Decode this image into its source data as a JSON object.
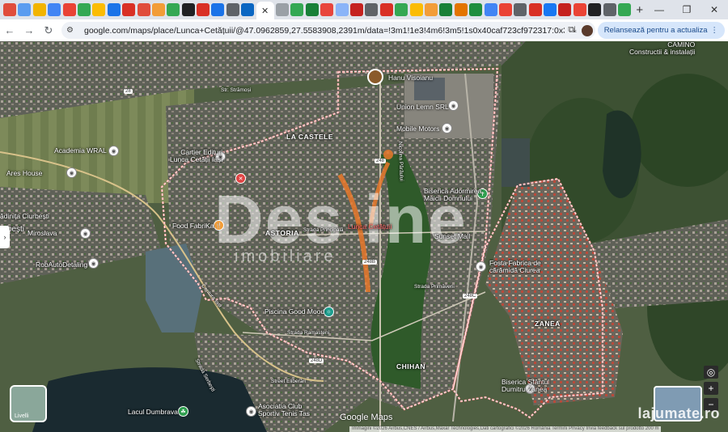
{
  "browser": {
    "url": "google.com/maps/place/Lunca+Cetățuii/@47.0962859,27.5583908,2391m/data=!3m1!1e3!4m6!3m5!1s0x40caf723cf972317:0x373eac97b60d4dbc!8m2!3d47.0968...",
    "relaunch_label": "Relansează pentru a actualiza",
    "tab_colors": [
      "#e04d3c",
      "#5a9cf0",
      "#f2b400",
      "#4285f4",
      "#e94235",
      "#34a853",
      "#fbbc04",
      "#1a73e8",
      "#d93025",
      "#e04d3c",
      "#f29d38",
      "#34a853",
      "#202124",
      "#d93025",
      "#1a73e8",
      "#5f6368",
      "#0a66c2",
      "#9aa0a6",
      "#34a853",
      "#188038",
      "#e8453c",
      "#8ab4f8",
      "#c5221f",
      "#5f6368",
      "#d93025",
      "#34a853",
      "#fbbc04",
      "#f29d38",
      "#188038",
      "#e37400",
      "#1e8e3e",
      "#4285f4",
      "#ea4335",
      "#5f6368",
      "#d93025",
      "#1877f2",
      "#c5221f",
      "#ea4335",
      "#202124",
      "#5f6368",
      "#34a853"
    ]
  },
  "map": {
    "areas": [
      "LA CASTELE",
      "ASTORIA",
      "ZANEA",
      "CHIHAN"
    ],
    "places": {
      "hanu": "Hanu Visoianu",
      "union": "Union Lemn SRL",
      "mobile": "Mobile Motors",
      "academia": "Academia WRAL",
      "cartier": "Cartier Edituri\nLunca Cetății Iași",
      "ares": "Ares House",
      "ciurbesti": "ădinița Ciurbești",
      "urbesti": "urbești",
      "miroslava": "Miroslava",
      "robauto": "RobAutoDetaling",
      "food": "Food FabriKa",
      "lunca": "Lunca Cetățuii",
      "biserica1": "Biserica Adormirea\nMaicii Domnului",
      "sunset": "Sunset Mall",
      "fosta": "Fosta Fabrica de\ncărămidă Ciurea",
      "piscina": "Piscina Good Mood",
      "biserica2": "Biserica Sfântul\nDumitru Zanea",
      "asociatia": "Asociatia Club\nSportiv Tenis Tas",
      "lacul": "Lacul Dumbrava",
      "camino": "CAMINO\nConstructii & instalații"
    },
    "roads": {
      "stramosi": "Str. Strămoși",
      "principala": "Strada Principală",
      "primaverii": "Strada Primăverii",
      "ramasteni": "Strada Ramasteni",
      "elibera": "Street Eliberări",
      "centura": "Centura Iași",
      "sherdesi": "Strada Serbești",
      "nicolina": "Nicolina Pârâului",
      "shield_248": "248",
      "shield_248b": "248B",
      "shield_248c": "248C",
      "shield_28": "28",
      "shield_248d": "248D"
    },
    "watermark": "Des ine",
    "watermark_sub": "imobiliare",
    "layers_label": "Livelli",
    "google_maps": "Google Maps",
    "attribution": "Immagini ©2026 Airbus,CNES / Airbus,Maxar Technologies,Dati cartografici ©2026   România   Termini   Privacy   Invia feedback sul prodotto   200 m",
    "lajumate": "lajumate.ro",
    "zoom_in": "+",
    "zoom_out": "−"
  }
}
